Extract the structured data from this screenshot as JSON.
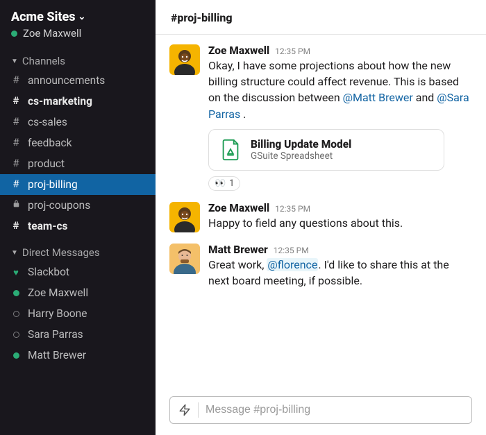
{
  "workspace": {
    "name": "Acme Sites",
    "current_user": "Zoe Maxwell"
  },
  "sidebar": {
    "channels_label": "Channels",
    "dms_label": "Direct Messages",
    "channels": [
      {
        "prefix": "#",
        "name": "announcements",
        "bold": false,
        "active": false,
        "locked": false
      },
      {
        "prefix": "#",
        "name": "cs-marketing",
        "bold": true,
        "active": false,
        "locked": false
      },
      {
        "prefix": "#",
        "name": "cs-sales",
        "bold": false,
        "active": false,
        "locked": false
      },
      {
        "prefix": "#",
        "name": "feedback",
        "bold": false,
        "active": false,
        "locked": false
      },
      {
        "prefix": "#",
        "name": "product",
        "bold": false,
        "active": false,
        "locked": false
      },
      {
        "prefix": "#",
        "name": "proj-billing",
        "bold": false,
        "active": true,
        "locked": false
      },
      {
        "prefix": "lock",
        "name": "proj-coupons",
        "bold": false,
        "active": false,
        "locked": true
      },
      {
        "prefix": "#",
        "name": "team-cs",
        "bold": true,
        "active": false,
        "locked": false
      }
    ],
    "dms": [
      {
        "name": "Slackbot",
        "status": "heart"
      },
      {
        "name": "Zoe Maxwell",
        "status": "online"
      },
      {
        "name": "Harry Boone",
        "status": "offline"
      },
      {
        "name": "Sara Parras",
        "status": "offline"
      },
      {
        "name": "Matt Brewer",
        "status": "online"
      }
    ]
  },
  "channel": {
    "name": "#proj-billing"
  },
  "messages": [
    {
      "author": "Zoe Maxwell",
      "time": "12:35 PM",
      "avatar": "zoe",
      "segments": [
        {
          "t": "text",
          "v": "Okay, I have some projections about how the new billing structure could affect revenue. This is based on the discussion between "
        },
        {
          "t": "mention",
          "v": "@Matt Brewer"
        },
        {
          "t": "text",
          "v": " and "
        },
        {
          "t": "mention",
          "v": "@Sara Parras"
        },
        {
          "t": "text",
          "v": " ."
        }
      ],
      "attachment": {
        "title": "Billing Update Model",
        "subtitle": "GSuite Spreadsheet",
        "icon": "gdrive"
      },
      "reactions": [
        {
          "emoji": "👀",
          "count": "1"
        }
      ]
    },
    {
      "author": "Zoe Maxwell",
      "time": "12:35 PM",
      "avatar": "zoe",
      "segments": [
        {
          "t": "text",
          "v": "Happy to field any questions about this."
        }
      ]
    },
    {
      "author": "Matt Brewer",
      "time": "12:35 PM",
      "avatar": "matt",
      "segments": [
        {
          "t": "text",
          "v": "Great work, "
        },
        {
          "t": "mention-hl",
          "v": "@florence"
        },
        {
          "t": "text",
          "v": ". I'd like to share this at the next board meeting, if possible."
        }
      ]
    }
  ],
  "composer": {
    "placeholder": "Message #proj-billing"
  }
}
